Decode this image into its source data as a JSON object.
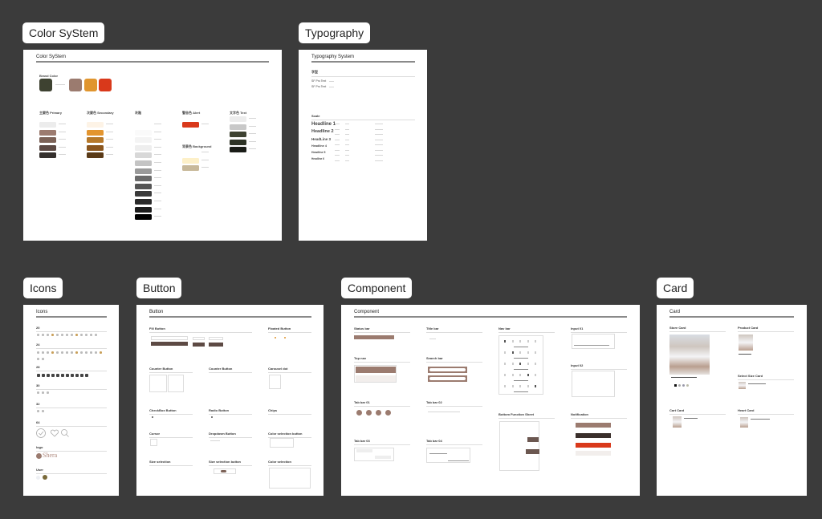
{
  "canvas": {
    "background": "#3b3b3b"
  },
  "frames": {
    "color": {
      "label": "Color SyStem",
      "title": "Color SyStem"
    },
    "typography": {
      "label": "Typography",
      "title": "Typography System"
    },
    "icons": {
      "label": "Icons",
      "title": "Icons"
    },
    "button": {
      "label": "Button",
      "title": "Button"
    },
    "component": {
      "label": "Component",
      "title": "Component"
    },
    "card": {
      "label": "Card",
      "title": "Card"
    }
  },
  "color_system": {
    "brand_label": "Brand Color",
    "brand": [
      "#3e4231",
      "#9b7b6f",
      "#e0952e",
      "#d9391b"
    ],
    "groups": [
      {
        "title": "主要色 Primary",
        "colors": [
          "#ececec",
          "#9c7b6f",
          "#7c6257",
          "#5d4a44",
          "#35302d"
        ]
      },
      {
        "title": "次要色 Secondary",
        "colors": [
          "#fdf3e6",
          "#e3952f",
          "#b7792a",
          "#8b561e",
          "#5a3a17"
        ]
      },
      {
        "title": "灰階",
        "colors": [
          "#ffffff",
          "#fafafa",
          "#f4f4f4",
          "#eeeeee",
          "#d8d8d8",
          "#c4c4c4",
          "#9a9a9a",
          "#6b6b6b",
          "#555555",
          "#3a3a3a",
          "#2a2a2a",
          "#1c1c1c",
          "#000000"
        ]
      },
      {
        "title": "警告色 Alert",
        "colors": [
          "#d9391b"
        ]
      },
      {
        "title": "背景色 Background",
        "colors": [
          "#ffffff",
          "#fdf0c8",
          "#c8b99a"
        ]
      },
      {
        "title": "文字色 Text",
        "colors": [
          "#ececec",
          "#c8c8c8",
          "#3e4231",
          "#2e3326",
          "#1a1c17"
        ]
      }
    ]
  },
  "typography": {
    "font_heading": "字型",
    "fonts": [
      "SF Pro Text",
      "SF Pro Text"
    ],
    "scale_heading": "Scale",
    "headlines": [
      "Headline 1",
      "Headline 2",
      "HeadLine 3",
      "Headline 4",
      "Headline 5",
      "Headline 6"
    ]
  },
  "icons": {
    "sections": [
      "20",
      "24",
      "28",
      "30",
      "32",
      "64",
      "logo",
      "User"
    ],
    "logo_text": "Shera"
  },
  "button": {
    "sections": [
      "Fill Button",
      "Floated Button",
      "Counter Button",
      "Counter Button",
      "Carousel dot",
      "CheckBox Button",
      "Radio Button",
      "Chips",
      "Cursor",
      "Dropdown Button",
      "Color selection button",
      "Size selection",
      "Size selection button",
      "Color selection"
    ]
  },
  "component": {
    "sections": [
      "Status bar",
      "Title bar",
      "Nav bar",
      "Input 01",
      "Top nav",
      "Search bar",
      "Input 02",
      "Tab bar 01",
      "Tab bar 02",
      "Bottom Function Sheet",
      "Notification",
      "Tab bar 03",
      "Tab bar 04"
    ],
    "accent": "#9b7b6f",
    "dark": "#4a3c37",
    "alert": "#d9391b"
  },
  "card": {
    "sections": [
      "Store Card",
      "Product Card",
      "Select Size Card",
      "Cart Card",
      "Heart Card"
    ]
  }
}
